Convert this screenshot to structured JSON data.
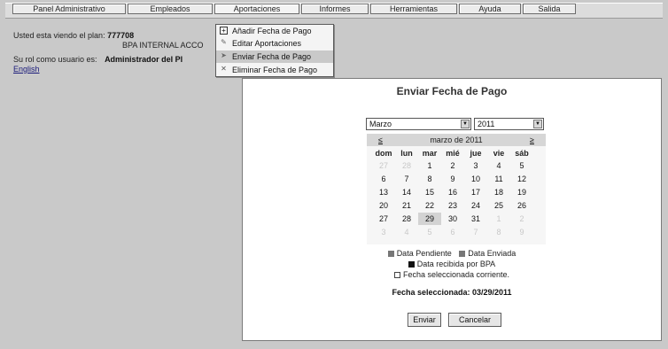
{
  "menu": [
    "Panel Administrativo",
    "Empleados",
    "Aportaciones",
    "Informes",
    "Herramientas",
    "Ayuda",
    "Salida"
  ],
  "info": {
    "plan_label": "Usted esta viendo el plan:",
    "plan_id": "777708",
    "plan_name": "BPA INTERNAL ACCO",
    "role_label": "Su rol como usuario es:",
    "role_value": "Administrador del Pl",
    "language_link": "English"
  },
  "dropdown": [
    {
      "label": "Añadir Fecha de Pago",
      "icon": "plus-icon"
    },
    {
      "label": "Editar Aportaciones",
      "icon": "edit-icon"
    },
    {
      "label": "Enviar Fecha de Pago",
      "icon": "send-icon"
    },
    {
      "label": "Eliminar Fecha de Pago",
      "icon": "delete-icon"
    }
  ],
  "dialog": {
    "title": "Enviar Fecha de Pago",
    "month_select": "Marzo",
    "year_select": "2011",
    "calendar_title": "marzo de 2011",
    "prev": "≤",
    "next": "≥",
    "weekdays": [
      "dom",
      "lun",
      "mar",
      "mié",
      "jue",
      "vie",
      "sáb"
    ],
    "weeks": [
      [
        "27",
        "28",
        "1",
        "2",
        "3",
        "4",
        "5"
      ],
      [
        "6",
        "7",
        "8",
        "9",
        "10",
        "11",
        "12"
      ],
      [
        "13",
        "14",
        "15",
        "16",
        "17",
        "18",
        "19"
      ],
      [
        "20",
        "21",
        "22",
        "23",
        "24",
        "25",
        "26"
      ],
      [
        "27",
        "28",
        "29",
        "30",
        "31",
        "1",
        "2"
      ],
      [
        "3",
        "4",
        "5",
        "6",
        "7",
        "8",
        "9"
      ]
    ],
    "legend": {
      "pending": "Data Pendiente",
      "sent": "Data Enviada",
      "received": "Data recibida por BPA",
      "current": "Fecha seleccionada corriente."
    },
    "selected_date": "Fecha seleccionada: 03/29/2011",
    "submit": "Enviar",
    "cancel": "Cancelar"
  },
  "colors": {
    "background": "#c9c9c9",
    "pending": "#777777",
    "sent": "#777777",
    "received": "#111111"
  }
}
